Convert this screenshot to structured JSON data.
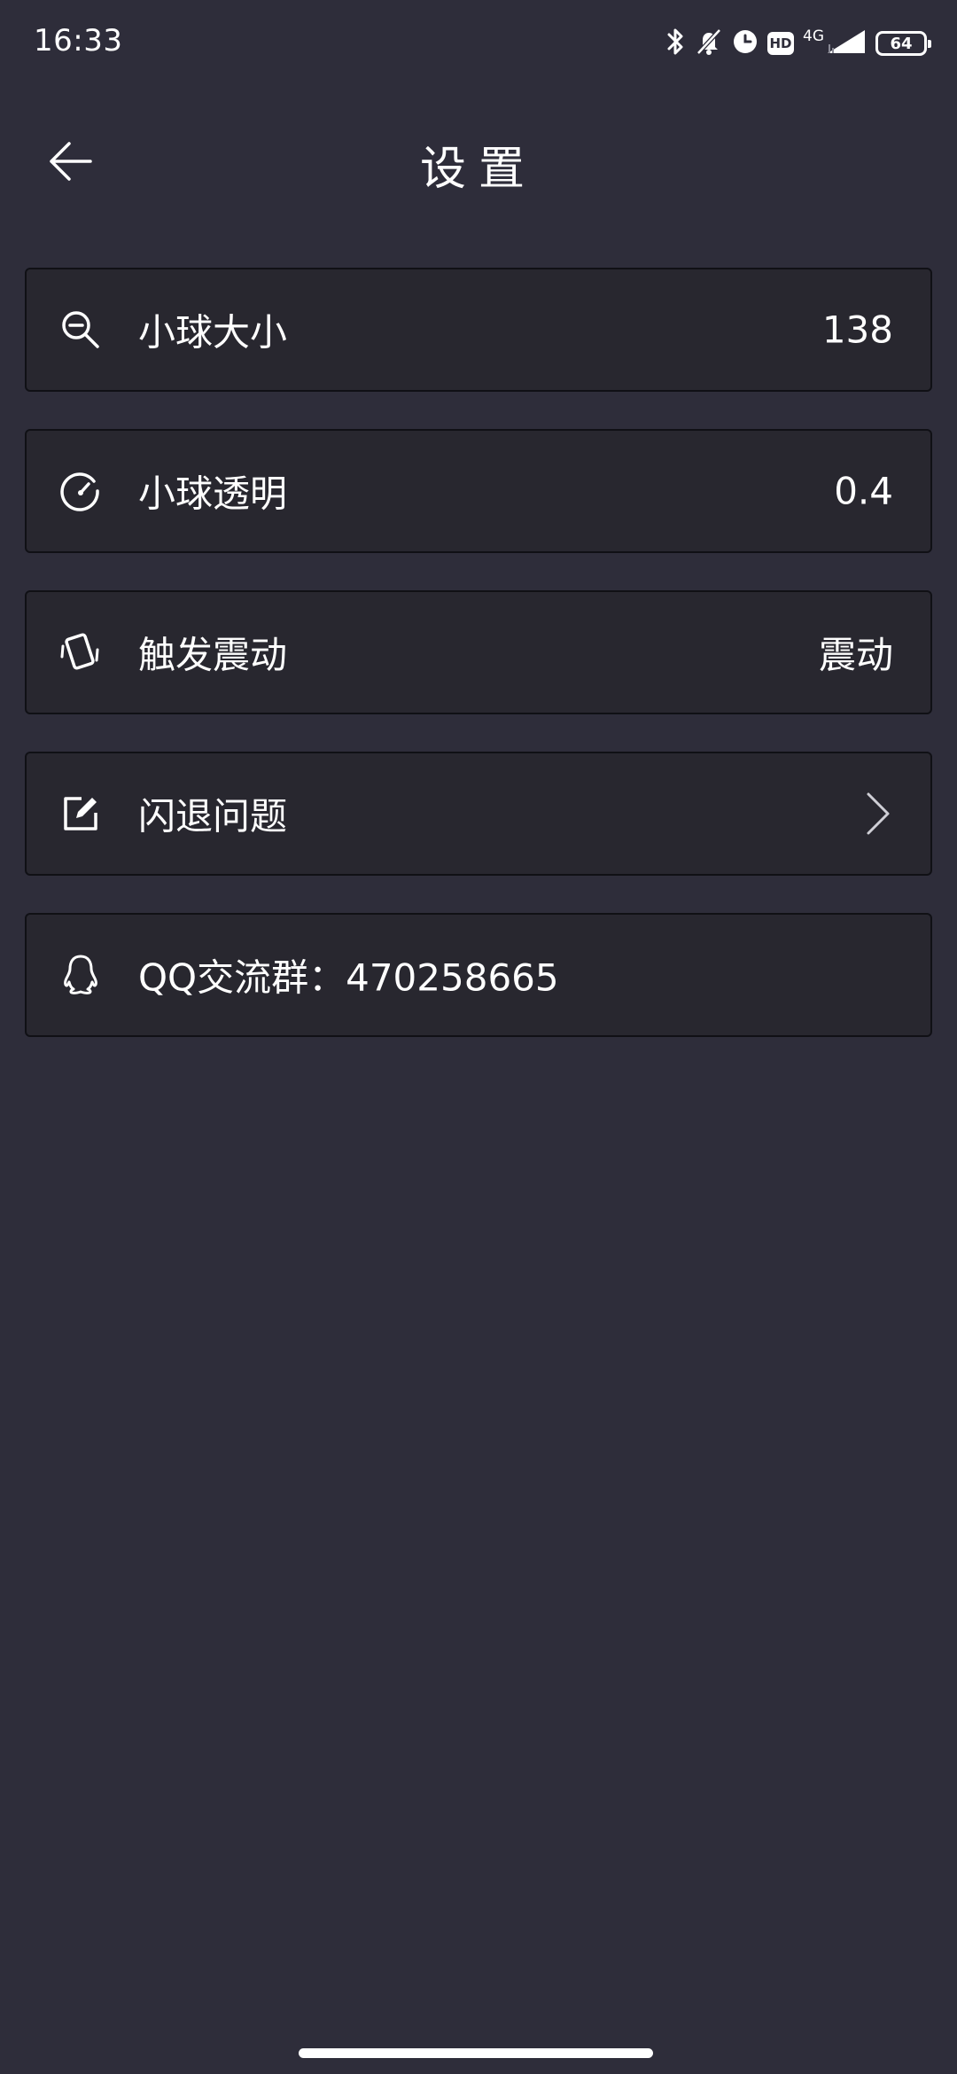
{
  "status_bar": {
    "time": "16:33",
    "hd_label": "HD",
    "network": "4G",
    "battery": "64",
    "icons": [
      "bluetooth-icon",
      "mute-bell-icon",
      "alarm-clock-icon",
      "hd-icon",
      "signal-icon",
      "battery-icon"
    ]
  },
  "header": {
    "title": "设置",
    "back_icon": "arrow-left-icon"
  },
  "settings": [
    {
      "icon": "zoom-out-icon",
      "label": "小球大小",
      "value": "138"
    },
    {
      "icon": "gauge-icon",
      "label": "小球透明",
      "value": "0.4"
    },
    {
      "icon": "vibrate-phone-icon",
      "label": "触发震动",
      "value": "震动"
    },
    {
      "icon": "edit-icon",
      "label": "闪退问题",
      "trailing_icon": "chevron-right-icon"
    },
    {
      "icon": "qq-penguin-icon",
      "label": "QQ交流群：470258665"
    }
  ],
  "colors": {
    "background": "#2e2d3a",
    "row_background": "#28272f",
    "row_border": "#101015",
    "text": "#ffffff"
  }
}
